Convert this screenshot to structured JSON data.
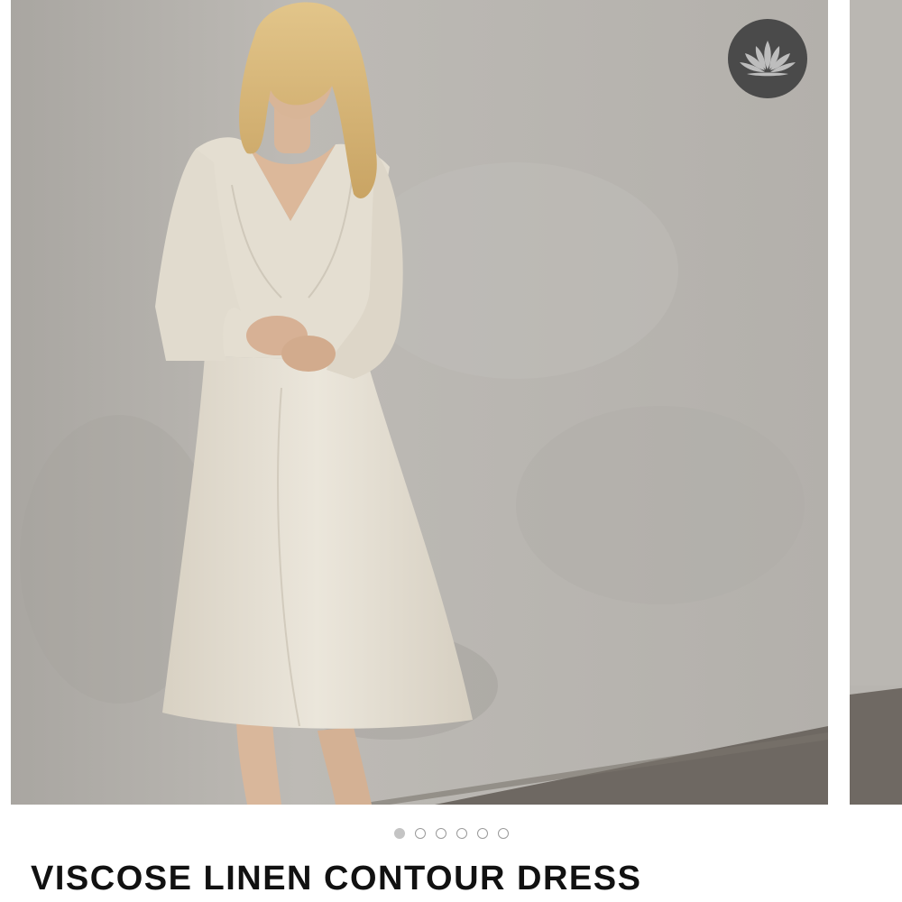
{
  "product": {
    "title": "VISCOSE LINEN CONTOUR DRESS"
  },
  "gallery": {
    "current_slide": 1,
    "slide_count": 6,
    "main_image_alt": "Model wearing a long-sleeve V-neck midi dress in natural linen against a grey plaster wall",
    "next_image_alt": "Next product image preview"
  },
  "brand": {
    "badge_icon": "lotus-icon"
  },
  "colors": {
    "wall": "#b9b6b1",
    "floor": "#6e6862",
    "dress": "#e6e0d3",
    "badge": "#4a4a4a",
    "title": "#111111"
  }
}
